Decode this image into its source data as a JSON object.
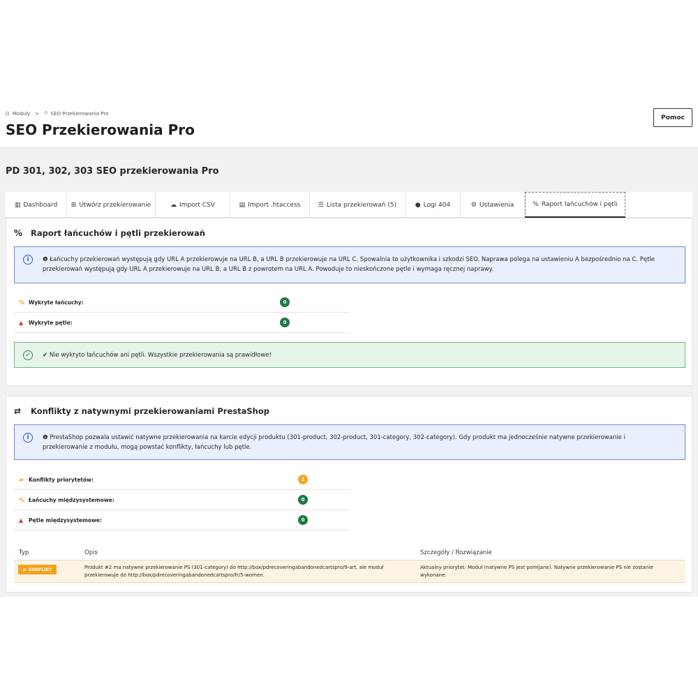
{
  "breadcrumb": {
    "item1": "Moduły",
    "separator": ">",
    "item2": "SEO Przekierowania Pro"
  },
  "page_title": "SEO Przekierowania Pro",
  "help_label": "Pomoc",
  "module_title": "PD 301, 302, 303 SEO przekierowania Pro",
  "tabs": [
    {
      "label": "Dashboard",
      "icon": "bar-chart-icon"
    },
    {
      "label": "Utwórz przekierowanie",
      "icon": "plus-square-icon"
    },
    {
      "label": "Import CSV",
      "icon": "cloud-upload-icon"
    },
    {
      "label": "Import .htaccess",
      "icon": "file-icon"
    },
    {
      "label": "Lista przekierowań (5)",
      "icon": "list-icon"
    },
    {
      "label": "Logi 404",
      "icon": "exclamation-circle-icon"
    },
    {
      "label": "Ustawienia",
      "icon": "cogs-icon"
    },
    {
      "label": "Raport łańcuchów i pętli",
      "icon": "link-icon"
    }
  ],
  "report_panel": {
    "title": "Raport łańcuchów i pętli przekierowań",
    "info_text": "❶ Łańcuchy przekierowań występują gdy URL A przekierowuje na URL B, a URL B przekierowuje na URL C. Spowalnia to użytkownika i szkodzi SEO. Naprawa polega na ustawieniu A bezpośrednio na C. Pętle przekierowań występują gdy URL A przekierowuje na URL B, a URL B z powrotem na URL A. Powoduje to nieskończone pętle i wymaga ręcznej naprawy.",
    "stats": [
      {
        "label": "Wykryte łańcuchy:",
        "value": "0"
      },
      {
        "label": "Wykryte pętle:",
        "value": "0"
      }
    ],
    "success_text": "✔ Nie wykryto łańcuchów ani pętli. Wszystkie przekierowania są prawidłowe!"
  },
  "conflicts_panel": {
    "title": "Konflikty z natywnymi przekierowaniami PrestaShop",
    "info_text": "❶ PrestaShop pozwala ustawić natywne przekierowania na karcie edycji produktu (301-product, 302-product, 301-category, 302-category). Gdy produkt ma jednocześnie natywne przekierowanie i przekierowanie z modułu, mogą powstać konflikty, łańcuchy lub pętle.",
    "stats": [
      {
        "label": "Konflikty priorytetów:",
        "value": "1"
      },
      {
        "label": "Łańcuchy międzysystemowe:",
        "value": "0"
      },
      {
        "label": "Pętle międzysystemowe:",
        "value": "0"
      }
    ],
    "table": {
      "headers": [
        "Typ",
        "Opis",
        "Szczegóły / Rozwiązanie"
      ],
      "rows": [
        {
          "type": "KONFLIKT",
          "description": "Produkt #2 ma natywne przekierowanie PS (301-category) do http://box/pdrecoveringabandonedcartspro/9-art, ale moduł przekierowuje do http://box/pdrecoveringabandonedcartspro/fr/5-women.",
          "details": "Aktualny priorytet: Moduł (natywne PS jest pomijane). Natywne przekierowanie PS nie zostanie wykonane."
        }
      ]
    }
  },
  "colors": {
    "info_bg": "#e9effc",
    "success_bg": "#e6f4ea",
    "badge_green": "#1f7a45",
    "badge_orange": "#f5a623",
    "conflict_row_bg": "#fdf3e2"
  }
}
